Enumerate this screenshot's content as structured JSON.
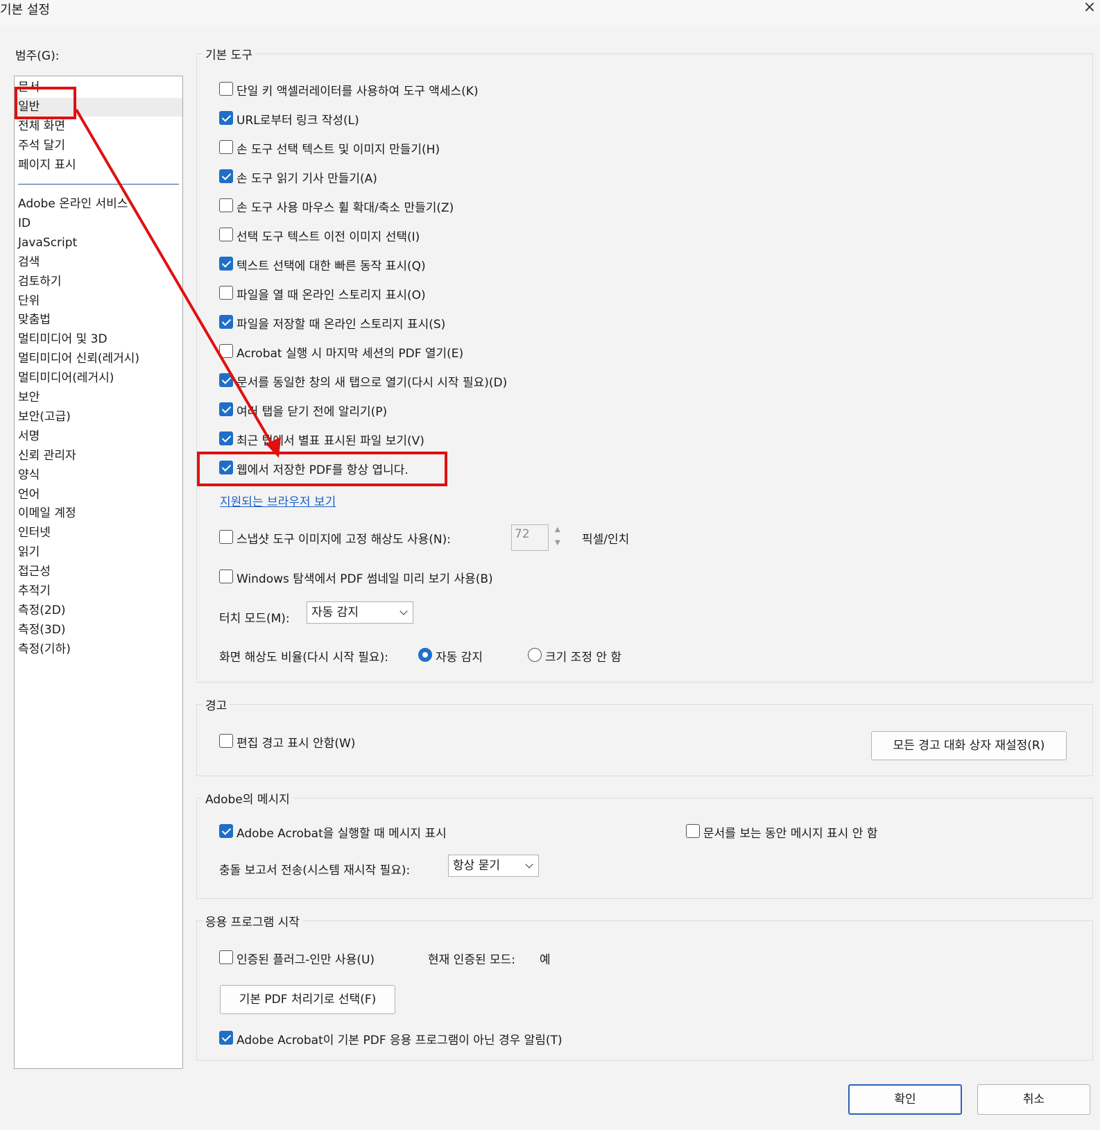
{
  "window": {
    "title": "기본 설정",
    "close": "×"
  },
  "category": {
    "label": "범주(G):",
    "top_items": [
      "문서",
      "일반",
      "전체 화면",
      "주석 달기",
      "페이지 표시"
    ],
    "items": [
      "Adobe 온라인 서비스",
      "ID",
      "JavaScript",
      "검색",
      "검토하기",
      "단위",
      "맞춤법",
      "멀티미디어 및 3D",
      "멀티미디어 신뢰(레거시)",
      "멀티미디어(레거시)",
      "보안",
      "보안(고급)",
      "서명",
      "신뢰 관리자",
      "양식",
      "언어",
      "이메일 계정",
      "인터넷",
      "읽기",
      "접근성",
      "추적기",
      "측정(2D)",
      "측정(3D)",
      "측정(기하)"
    ],
    "selected": "일반"
  },
  "basic_tools": {
    "title": "기본 도구",
    "options": [
      {
        "label": "단일 키 액셀러레이터를 사용하여 도구 액세스(K)",
        "checked": false
      },
      {
        "label": "URL로부터 링크 작성(L)",
        "checked": true
      },
      {
        "label": "손 도구 선택 텍스트 및 이미지 만들기(H)",
        "checked": false
      },
      {
        "label": "손 도구 읽기 기사 만들기(A)",
        "checked": true
      },
      {
        "label": "손 도구 사용 마우스 휠 확대/축소 만들기(Z)",
        "checked": false
      },
      {
        "label": "선택 도구 텍스트 이전 이미지 선택(I)",
        "checked": false
      },
      {
        "label": "텍스트 선택에 대한 빠른 동작 표시(Q)",
        "checked": true
      },
      {
        "label": "파일을 열 때 온라인 스토리지 표시(O)",
        "checked": false
      },
      {
        "label": "파일을 저장할 때 온라인 스토리지 표시(S)",
        "checked": true
      },
      {
        "label": "Acrobat 실행 시 마지막 세션의 PDF 열기(E)",
        "checked": false
      },
      {
        "label": "문서를 동일한 창의 새 탭으로 열기(다시 시작 필요)(D)",
        "checked": true
      },
      {
        "label": "여러 탭을 닫기 전에 알리기(P)",
        "checked": true
      },
      {
        "label": "최근 탭에서 별표 표시된 파일 보기(V)",
        "checked": true
      },
      {
        "label": "웹에서 저장한 PDF를 항상 엽니다.",
        "checked": true
      }
    ],
    "browser_link": "지원되는 브라우저 보기",
    "snapshot": {
      "label": "스냅샷 도구 이미지에 고정 해상도 사용(N):",
      "checked": false,
      "value": "72",
      "unit": "픽셀/인치"
    },
    "windows_thumb": {
      "label": "Windows 탐색에서 PDF 썸네일 미리 보기 사용(B)",
      "checked": false
    },
    "touch_mode": {
      "label": "터치 모드(M):",
      "value": "자동 감지"
    },
    "resolution": {
      "label": "화면 해상도 비율(다시 시작 필요):",
      "opt1": "자동 감지",
      "opt2": "크기 조정 안 함",
      "selected": "자동 감지"
    }
  },
  "warnings": {
    "title": "경고",
    "edit_warning": {
      "label": "편집 경고 표시 안함(W)",
      "checked": false
    },
    "reset_button": "모든 경고 대화 상자 재설정(R)"
  },
  "messages": {
    "title": "Adobe의 메시지",
    "show_on_launch": {
      "label": "Adobe Acrobat을 실행할 때 메시지 표시",
      "checked": true
    },
    "hide_while_viewing": {
      "label": "문서를 보는 동안 메시지 표시 안 함",
      "checked": false
    },
    "crash_label": "충돌 보고서 전송(시스템 재시작 필요):",
    "crash_value": "항상 묻기"
  },
  "startup": {
    "title": "응용 프로그램 시작",
    "certified": {
      "label": "인증된 플러그-인만 사용(U)",
      "checked": false
    },
    "mode_label": "현재 인증된 모드:",
    "mode_value": "예",
    "default_handler_button": "기본 PDF 처리기로 선택(F)",
    "notify": {
      "label": "Adobe Acrobat이 기본 PDF 응용 프로그램이 아닌 경우 알림(T)",
      "checked": true
    }
  },
  "footer": {
    "ok": "확인",
    "cancel": "취소"
  },
  "colors": {
    "accent": "#1f6fc8",
    "annotation": "#e01010",
    "link": "#1a5fc9"
  }
}
